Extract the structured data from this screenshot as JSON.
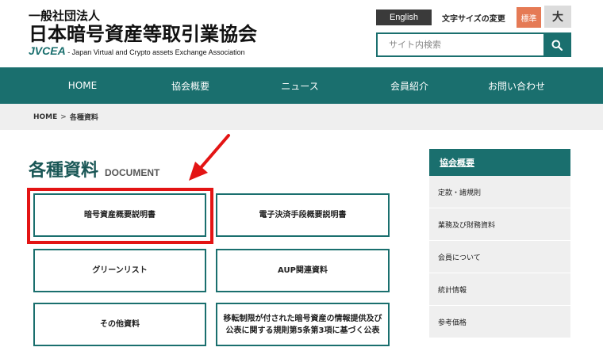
{
  "header": {
    "org_type": "一般社団法人",
    "org_name": "日本暗号資産等取引業協会",
    "org_abbr": "JVCEA",
    "org_english": " - Japan Virtual and Crypto assets Exchange Association",
    "english_label": "English",
    "font_size_label": "文字サイズの変更",
    "font_size_standard": "標準",
    "font_size_large": "大",
    "search_placeholder": "サイト内検索"
  },
  "nav": {
    "items": [
      {
        "label": "HOME"
      },
      {
        "label": "協会概要"
      },
      {
        "label": "ニュース"
      },
      {
        "label": "会員紹介"
      },
      {
        "label": "お問い合わせ"
      }
    ]
  },
  "breadcrumb": {
    "home": "HOME",
    "separator": ">",
    "current": "各種資料"
  },
  "main": {
    "title": "各種資料",
    "title_en": "DOCUMENT",
    "docs": [
      {
        "label": "暗号資産概要説明書"
      },
      {
        "label": "電子決済手段概要説明書"
      },
      {
        "label": "グリーンリスト"
      },
      {
        "label": "AUP関連資料"
      },
      {
        "label": "その他資料"
      },
      {
        "label": "移転制限が付された暗号資産の情報提供及び公表に関する規則第5条第3項に基づく公表"
      }
    ]
  },
  "sidebar": {
    "heading": "協会概要",
    "items": [
      {
        "label": "定款・諸規則"
      },
      {
        "label": "業務及び財務資料"
      },
      {
        "label": "会員について"
      },
      {
        "label": "統計情報"
      },
      {
        "label": "参考価格"
      }
    ]
  },
  "colors": {
    "brand": "#1a6f6e",
    "highlight": "#e31414",
    "font_standard_bg": "#e57a55"
  },
  "icons": {
    "search": "search-icon",
    "arrow": "red-arrow-icon"
  }
}
